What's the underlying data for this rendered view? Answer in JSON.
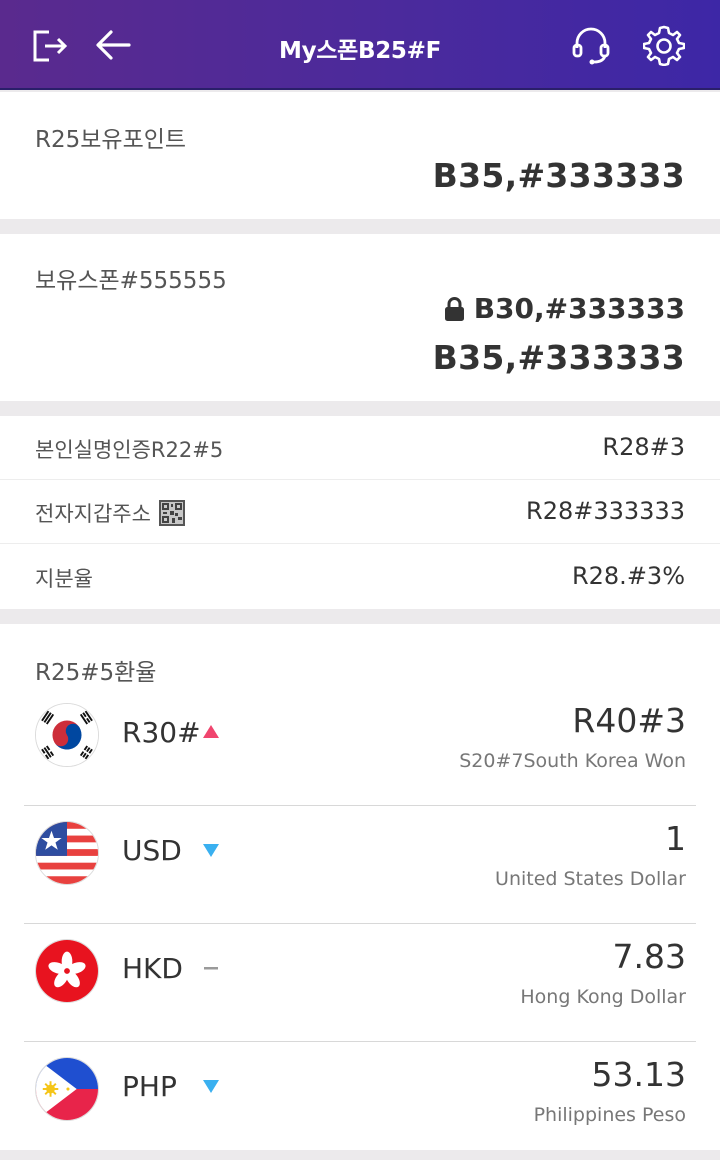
{
  "header": {
    "title": "My스폰B25#F",
    "icons": [
      "logout-icon",
      "back-arrow-icon",
      "headset-icon",
      "gear-icon"
    ],
    "background": "#4b2a9c"
  },
  "points": {
    "label": "R25보유포인트",
    "value": "B35,#333333"
  },
  "spon": {
    "label": "보유스폰#555555",
    "locked_value": "B30,#333333",
    "value": "B35,#333333"
  },
  "info": {
    "rows": [
      {
        "label": "본인실명인증R22#5",
        "value": "R28#3"
      },
      {
        "label": "전자지갑주소",
        "value": "R28#333333"
      },
      {
        "label": "지분율",
        "value": "R28.#3%"
      }
    ]
  },
  "exchange": {
    "title": "R25#5환율",
    "rows": [
      {
        "code": "R30#",
        "trend": "up",
        "trend_color": "#f0456e",
        "rate": "R40#3",
        "name": "S20#7South Korea Won",
        "flag": "south-korea-flag-icon"
      },
      {
        "code": "USD",
        "trend": "down",
        "trend_color": "#3ab0f0",
        "rate": "1",
        "name": "United States Dollar",
        "flag": "us-flag-icon"
      },
      {
        "code": "HKD",
        "trend": "flat",
        "trend_color": "#9a9a9a",
        "rate": "7.83",
        "name": "Hong Kong Dollar",
        "flag": "hong-kong-flag-icon"
      },
      {
        "code": "PHP",
        "trend": "down",
        "trend_color": "#3ab0f0",
        "rate": "53.13",
        "name": "Philippines Peso",
        "flag": "philippines-flag-icon"
      }
    ]
  }
}
